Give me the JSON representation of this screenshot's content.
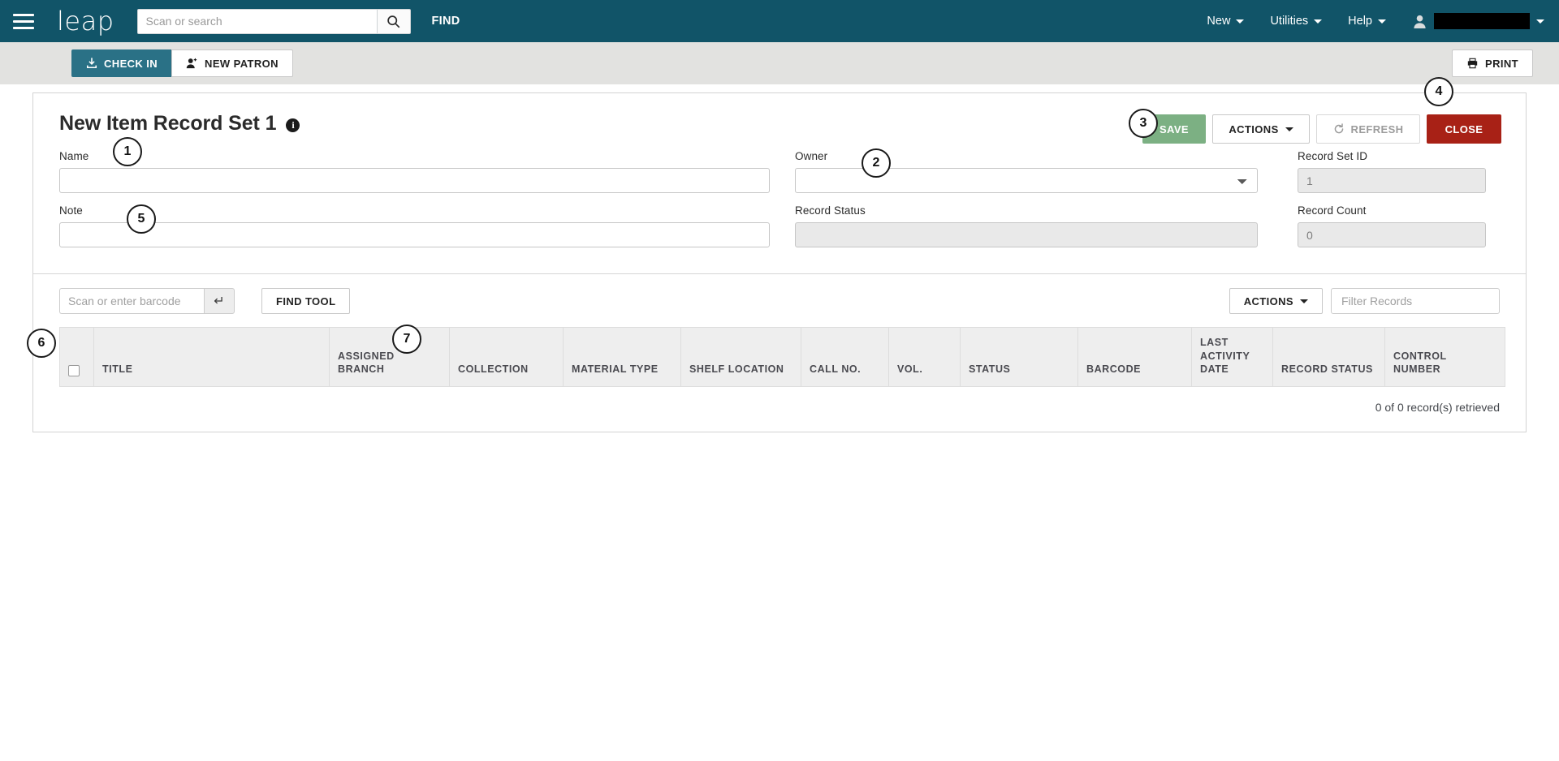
{
  "navbar": {
    "menu_icon": "hamburger-icon",
    "brand": "leap",
    "search": {
      "placeholder": "Scan or search",
      "value": "",
      "icon": "search-icon"
    },
    "find_label": "FIND",
    "items": [
      {
        "label": "New",
        "icon": "chevron-down-icon"
      },
      {
        "label": "Utilities",
        "icon": "chevron-down-icon"
      },
      {
        "label": "Help",
        "icon": "chevron-down-icon"
      }
    ],
    "user": {
      "icon": "user-icon",
      "name": "",
      "redacted": true,
      "caret": "chevron-down-icon"
    },
    "color": "#115468"
  },
  "toolbar": {
    "check_in_label": "CHECK IN",
    "check_in_icon": "check-in-icon",
    "new_patron_label": "NEW PATRON",
    "new_patron_icon": "add-patron-icon",
    "print_label": "PRINT",
    "print_icon": "printer-icon",
    "background": "#e2e2e0"
  },
  "record_set": {
    "title": "New Item Record Set 1",
    "info_icon": "info-icon",
    "actions": {
      "save_label": "SAVE",
      "save_color": "#7cb083",
      "actions_label": "ACTIONS",
      "actions_caret": "chevron-down-icon",
      "refresh_label": "REFRESH",
      "refresh_icon": "refresh-icon",
      "close_label": "CLOSE",
      "close_color": "#a82116"
    },
    "fields": {
      "name": {
        "label": "Name",
        "value": "",
        "placeholder": ""
      },
      "note": {
        "label": "Note",
        "value": "",
        "placeholder": ""
      },
      "owner": {
        "label": "Owner",
        "value": "",
        "options": [
          ""
        ]
      },
      "record_status": {
        "label": "Record Status",
        "value": "",
        "readonly": true
      },
      "record_set_id": {
        "label": "Record Set ID",
        "value": "1",
        "readonly": true
      },
      "record_count": {
        "label": "Record Count",
        "value": "0",
        "readonly": true
      }
    }
  },
  "records": {
    "barcode": {
      "placeholder": "Scan or enter barcode",
      "value": "",
      "enter_icon": "enter-key-icon"
    },
    "find_tool_label": "FIND TOOL",
    "actions_label": "ACTIONS",
    "actions_caret": "chevron-down-icon",
    "filter": {
      "placeholder": "Filter Records",
      "value": ""
    },
    "columns": [
      {
        "key": "select",
        "lines": [
          ""
        ]
      },
      {
        "key": "title",
        "lines": [
          "TITLE"
        ]
      },
      {
        "key": "assigned_branch",
        "lines": [
          "ASSIGNED",
          "BRANCH"
        ]
      },
      {
        "key": "collection",
        "lines": [
          "COLLECTION"
        ]
      },
      {
        "key": "material_type",
        "lines": [
          "MATERIAL TYPE"
        ]
      },
      {
        "key": "shelf_location",
        "lines": [
          "SHELF LOCATION"
        ]
      },
      {
        "key": "call_no",
        "lines": [
          "CALL NO."
        ]
      },
      {
        "key": "vol",
        "lines": [
          "VOL."
        ]
      },
      {
        "key": "status",
        "lines": [
          "STATUS"
        ]
      },
      {
        "key": "barcode",
        "lines": [
          "BARCODE"
        ]
      },
      {
        "key": "last_activity_date",
        "lines": [
          "LAST",
          "ACTIVITY",
          "DATE"
        ]
      },
      {
        "key": "record_status",
        "lines": [
          "RECORD STATUS"
        ]
      },
      {
        "key": "control_number",
        "lines": [
          "CONTROL",
          "NUMBER"
        ]
      }
    ],
    "rows": [],
    "retrieved_text": "0 of 0 record(s) retrieved"
  },
  "callouts": [
    {
      "number": "1",
      "target": "name-field"
    },
    {
      "number": "2",
      "target": "owner-field"
    },
    {
      "number": "3",
      "target": "save-button"
    },
    {
      "number": "4",
      "target": "close-button"
    },
    {
      "number": "5",
      "target": "note-field"
    },
    {
      "number": "6",
      "target": "barcode-input"
    },
    {
      "number": "7",
      "target": "find-tool-button"
    }
  ]
}
